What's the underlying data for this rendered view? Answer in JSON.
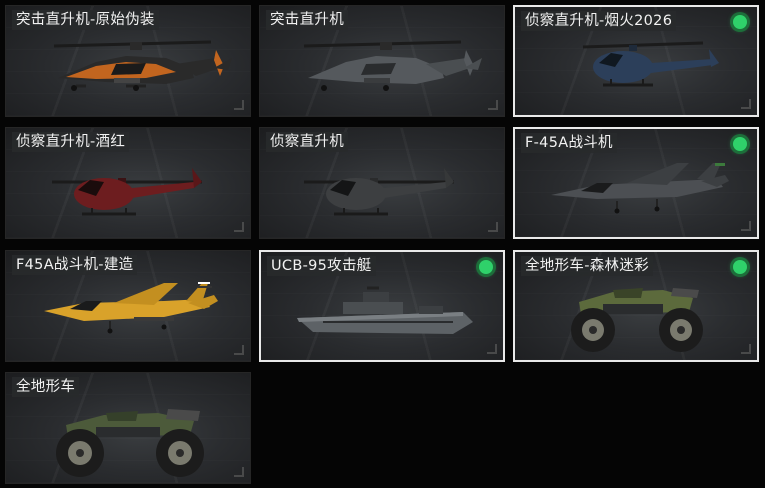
{
  "items": [
    {
      "label": "突击直升机-原始伪装",
      "model": "attack-helicopter",
      "selected": false,
      "checked": false,
      "color": "#c2651f"
    },
    {
      "label": "突击直升机",
      "model": "attack-helicopter",
      "selected": false,
      "checked": false,
      "color": "#55595d"
    },
    {
      "label": "侦察直升机-烟火2026",
      "model": "scout-helicopter",
      "selected": true,
      "checked": true,
      "color": "#2c3f5a"
    },
    {
      "label": "侦察直升机-酒红",
      "model": "scout-helicopter",
      "selected": false,
      "checked": false,
      "color": "#6d1d1f"
    },
    {
      "label": "侦察直升机",
      "model": "scout-helicopter",
      "selected": false,
      "checked": false,
      "color": "#3d3f41"
    },
    {
      "label": "F-45A战斗机",
      "model": "fighter-jet",
      "selected": true,
      "checked": true,
      "color": "#4c4f53"
    },
    {
      "label": "F45A战斗机-建造",
      "model": "fighter-jet",
      "selected": false,
      "checked": false,
      "color": "#d9a22a"
    },
    {
      "label": "UCB-95攻击艇",
      "model": "attack-boat",
      "selected": true,
      "checked": true,
      "color": "#5d6266"
    },
    {
      "label": "全地形车-森林迷彩",
      "model": "atv",
      "selected": true,
      "checked": true,
      "color": "#5c6a3c"
    },
    {
      "label": "全地形车",
      "model": "atv",
      "selected": false,
      "checked": false,
      "color": "#4c5a3a"
    }
  ],
  "accent_color": "#2fd16a"
}
